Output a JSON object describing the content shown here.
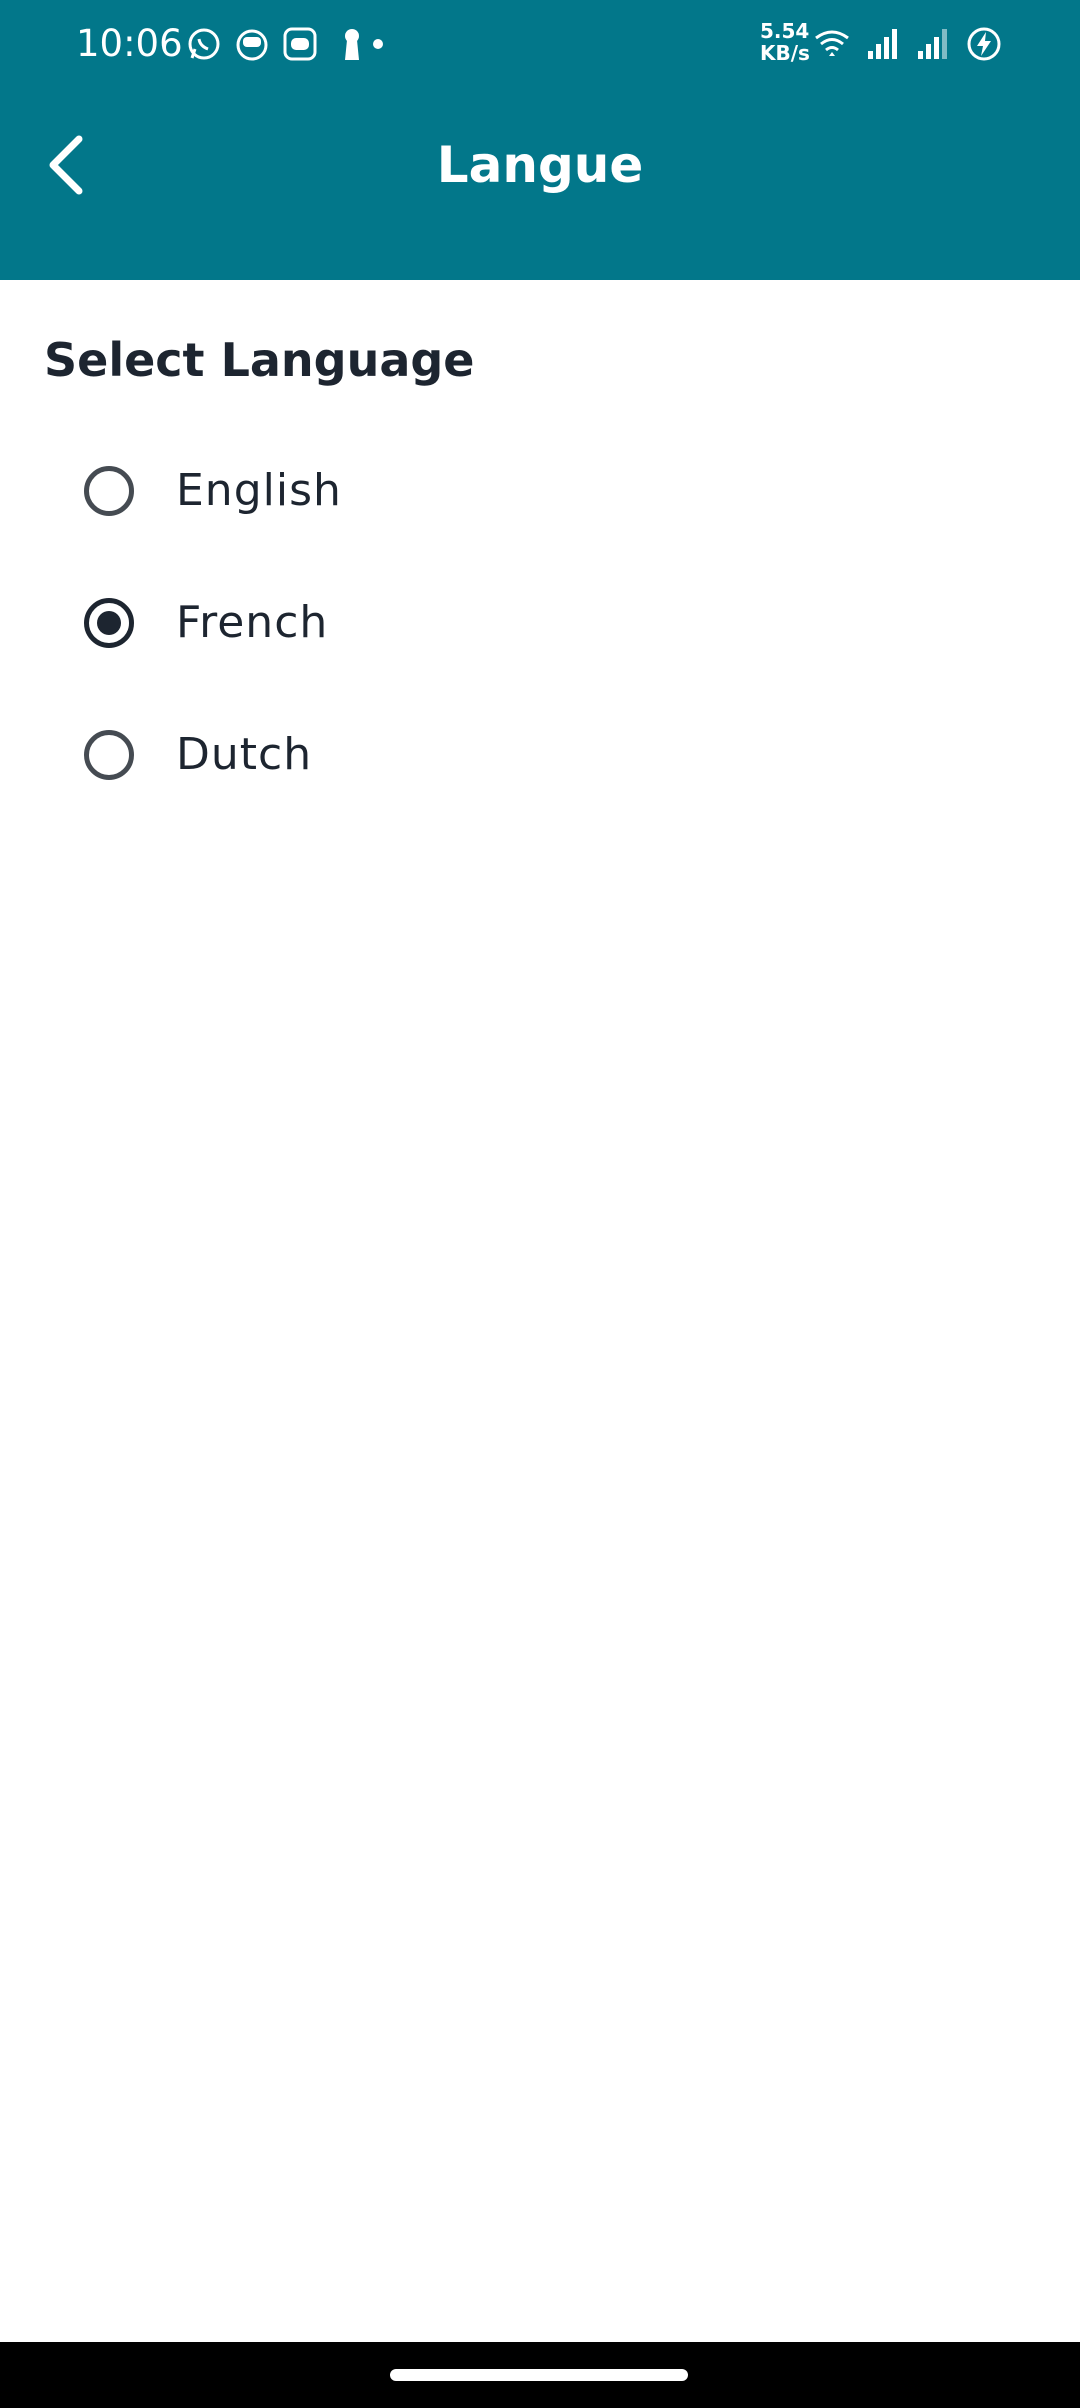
{
  "status_bar": {
    "time": "10:06",
    "net_speed_value": "5.54",
    "net_speed_unit": "KB/s",
    "icons": [
      "whatsapp-icon",
      "messenger-icon",
      "cb-app-icon",
      "keyhole-icon",
      "dot-icon",
      "wifi-icon",
      "signal-icon",
      "signal-icon",
      "battery-charging-icon"
    ]
  },
  "header": {
    "title": "Langue",
    "back_icon": "chevron-left-icon",
    "background_color": "#02778a"
  },
  "main": {
    "heading": "Select Language",
    "options": [
      {
        "label": "English",
        "selected": false
      },
      {
        "label": "French",
        "selected": true
      },
      {
        "label": "Dutch",
        "selected": false
      }
    ]
  }
}
